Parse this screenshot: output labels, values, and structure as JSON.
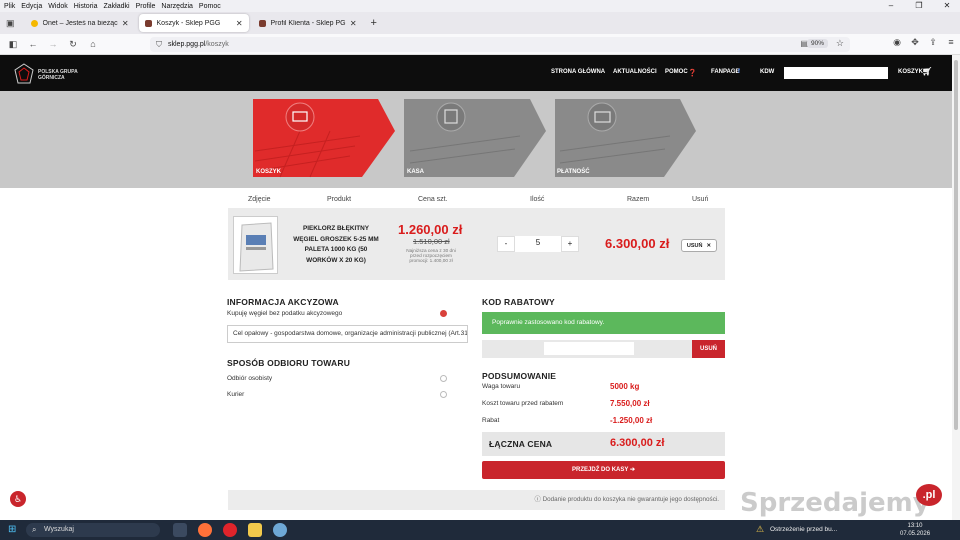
{
  "menubar": {
    "items": [
      "Plik",
      "Edycja",
      "Widok",
      "Historia",
      "Zakładki",
      "Profile",
      "Narzędzia",
      "Pomoc"
    ]
  },
  "tabs": [
    {
      "title": "Onet – Jesteś na bieżąco",
      "color": "#f5b800"
    },
    {
      "title": "Koszyk - Sklep PGG",
      "color": "#7a3b2e"
    },
    {
      "title": "Profil Klienta - Sklep PGG",
      "color": "#7a3b2e"
    }
  ],
  "browser": {
    "url_domain": "sklep.pgg.pl",
    "url_path": "/koszyk",
    "zoom": "90%"
  },
  "site": {
    "logo_text": [
      "POLSKA GRUPA",
      "GÓRNICZA"
    ],
    "nav": [
      "STRONA GŁÓWNA",
      "AKTUALNOŚCI",
      "POMOC",
      "FANPAGE",
      "KDW",
      "KOSZYK"
    ],
    "steps": [
      "KOSZYK",
      "KASA",
      "PŁATNOŚĆ"
    ]
  },
  "cart": {
    "headers": [
      "Zdjęcie",
      "Produkt",
      "Cena szt.",
      "Ilość",
      "Razem",
      "Usuń"
    ],
    "item": {
      "name": "PIEKLORZ BŁĘKITNY WĘGIEL GROSZEK 5-25 MM PALETA 1000 KG (50 WORKÓW X 20 KG)",
      "price": "1.260,00 zł",
      "old_price": "1.510,00 zł",
      "price_note": "Najniższa cena z 30 dni przed rozpoczęciem promocji: 1.400,00 zł",
      "qty": "5",
      "minus": "-",
      "plus": "+",
      "total": "6.300,00 zł",
      "remove": "USUŃ"
    }
  },
  "excise": {
    "title": "INFORMACJA AKCYZOWA",
    "checkbox_label": "Kupuję węgiel bez podatku akcyzowego",
    "select_value": "Cel opałowy - gospodarstwa domowe, organizacje administracji publicznej (Art.31b u"
  },
  "shipping": {
    "title": "SPOSÓB ODBIORU TOWARU",
    "options": [
      "Odbiór osobisty",
      "Kurier"
    ]
  },
  "coupon": {
    "title": "KOD RABATOWY",
    "success": "Poprawnie zastosowano kod rabatowy.",
    "remove": "USUŃ"
  },
  "summary": {
    "title": "PODSUMOWANIE",
    "rows": [
      {
        "label": "Waga towaru",
        "value": "5000 kg"
      },
      {
        "label": "Koszt towaru przed rabatem",
        "value": "7.550,00 zł"
      },
      {
        "label": "Rabat",
        "value": "-1.250,00 zł"
      }
    ],
    "total_label": "ŁĄCZNA CENA",
    "total_value": "6.300,00 zł",
    "checkout": "PRZEJDŹ DO KASY"
  },
  "info": "Dodanie produktu do koszyka nie gwarantuje jego dostępności.",
  "taskbar": {
    "search": "Wyszukaj",
    "notification": "Ostrzeżenie przed bu...",
    "time": "13:10",
    "date": "07.05.2026"
  },
  "watermark": {
    "text": "Sprzedajemy",
    "badge": ".pl"
  },
  "colors": {
    "accent": "#d91c1c",
    "success": "#5cb85c",
    "header": "#0d0d0d"
  }
}
